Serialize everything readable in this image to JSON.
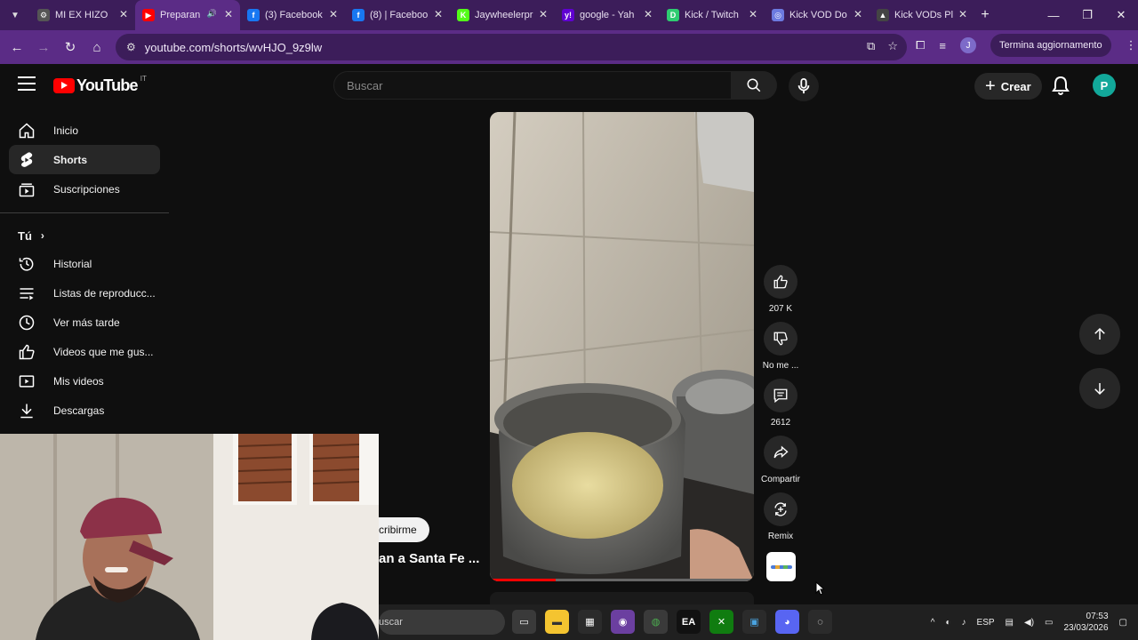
{
  "browser": {
    "tabs": [
      {
        "title": "MI EX HIZO",
        "favicon": "gear-icon",
        "color": "#555555",
        "glyph": "⚙"
      },
      {
        "title": "Preparan",
        "favicon": "youtube-icon",
        "color": "#ff0000",
        "glyph": "▶",
        "active": true
      },
      {
        "title": "(3) Facebook",
        "favicon": "facebook-icon",
        "color": "#1877f2",
        "glyph": "f"
      },
      {
        "title": "(8) | Faceboo",
        "favicon": "facebook-icon",
        "color": "#1877f2",
        "glyph": "f"
      },
      {
        "title": "Jaywheelerpr",
        "favicon": "kick-icon",
        "color": "#53fc18",
        "glyph": "K"
      },
      {
        "title": "google - Yah",
        "favicon": "yahoo-icon",
        "color": "#6001d2",
        "glyph": "y!"
      },
      {
        "title": "Kick / Twitch",
        "favicon": "d-icon",
        "color": "#2ecc71",
        "glyph": "D"
      },
      {
        "title": "Kick VOD Do",
        "favicon": "globe-icon",
        "color": "#6c7ae0",
        "glyph": "◎"
      },
      {
        "title": "Kick VODs Pl",
        "favicon": "bell-icon",
        "color": "#444444",
        "glyph": "▲"
      }
    ],
    "url": "youtube.com/shorts/wvHJO_9z9lw",
    "update_label": "Termina aggiornamento",
    "profile_initial": "J"
  },
  "youtube": {
    "logo_text": "YouTube",
    "country_code": "IT",
    "search_placeholder": "Buscar",
    "create_label": "Crear",
    "avatar_initial": "P"
  },
  "sidebar": {
    "items": [
      {
        "label": "Inicio",
        "icon": "home-icon"
      },
      {
        "label": "Shorts",
        "icon": "shorts-icon",
        "active": true
      },
      {
        "label": "Suscripciones",
        "icon": "subscriptions-icon"
      }
    ],
    "you_label": "Tú",
    "you_items": [
      {
        "label": "Historial",
        "icon": "history-icon"
      },
      {
        "label": "Listas de reproducc...",
        "icon": "playlists-icon"
      },
      {
        "label": "Ver más tarde",
        "icon": "watch-later-icon"
      },
      {
        "label": "Videos que me gus...",
        "icon": "liked-icon"
      },
      {
        "label": "Mis videos",
        "icon": "my-videos-icon"
      },
      {
        "label": "Descargas",
        "icon": "downloads-icon"
      }
    ]
  },
  "short": {
    "subscribe_label": "cribirme",
    "title": "an a Santa Fe ...",
    "likes": "207 K",
    "dislike_label": "No me ...",
    "comments": "2612",
    "share_label": "Compartir",
    "remix_label": "Remix",
    "progress": 0.25
  },
  "taskbar": {
    "search_text": "uscar",
    "language": "ESP",
    "time": "07:53",
    "date": "23/03/2026"
  }
}
